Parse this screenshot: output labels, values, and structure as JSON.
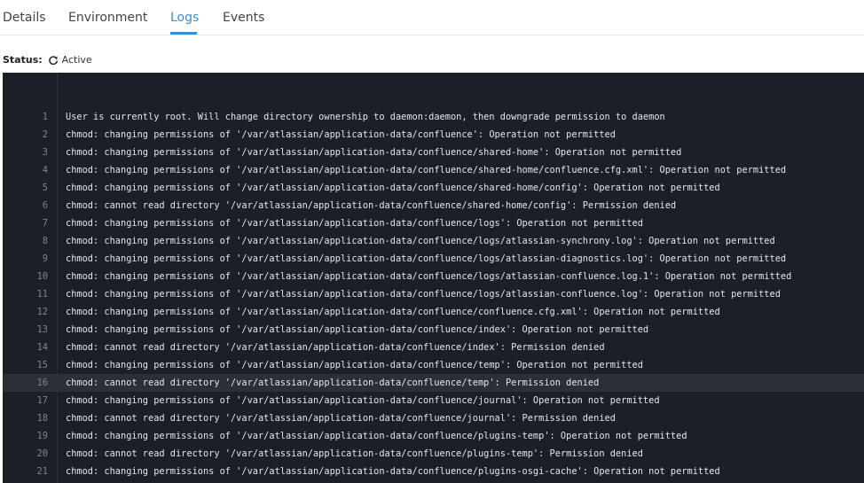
{
  "tabs": [
    {
      "label": "Details"
    },
    {
      "label": "Environment"
    },
    {
      "label": "Logs"
    },
    {
      "label": "Events"
    }
  ],
  "active_tab": "Logs",
  "status": {
    "label": "Status:",
    "icon": "refresh-icon",
    "value": "Active"
  },
  "log": {
    "highlighted_line": 16,
    "lines": [
      {
        "n": "1",
        "text": "User is currently root. Will change directory ownership to daemon:daemon, then downgrade permission to daemon"
      },
      {
        "n": "2",
        "text": "chmod: changing permissions of '/var/atlassian/application-data/confluence': Operation not permitted"
      },
      {
        "n": "3",
        "text": "chmod: changing permissions of '/var/atlassian/application-data/confluence/shared-home': Operation not permitted"
      },
      {
        "n": "4",
        "text": "chmod: changing permissions of '/var/atlassian/application-data/confluence/shared-home/confluence.cfg.xml': Operation not permitted"
      },
      {
        "n": "5",
        "text": "chmod: changing permissions of '/var/atlassian/application-data/confluence/shared-home/config': Operation not permitted"
      },
      {
        "n": "6",
        "text": "chmod: cannot read directory '/var/atlassian/application-data/confluence/shared-home/config': Permission denied"
      },
      {
        "n": "7",
        "text": "chmod: changing permissions of '/var/atlassian/application-data/confluence/logs': Operation not permitted"
      },
      {
        "n": "8",
        "text": "chmod: changing permissions of '/var/atlassian/application-data/confluence/logs/atlassian-synchrony.log': Operation not permitted"
      },
      {
        "n": "9",
        "text": "chmod: changing permissions of '/var/atlassian/application-data/confluence/logs/atlassian-diagnostics.log': Operation not permitted"
      },
      {
        "n": "10",
        "text": "chmod: changing permissions of '/var/atlassian/application-data/confluence/logs/atlassian-confluence.log.1': Operation not permitted"
      },
      {
        "n": "11",
        "text": "chmod: changing permissions of '/var/atlassian/application-data/confluence/logs/atlassian-confluence.log': Operation not permitted"
      },
      {
        "n": "12",
        "text": "chmod: changing permissions of '/var/atlassian/application-data/confluence/confluence.cfg.xml': Operation not permitted"
      },
      {
        "n": "13",
        "text": "chmod: changing permissions of '/var/atlassian/application-data/confluence/index': Operation not permitted"
      },
      {
        "n": "14",
        "text": "chmod: cannot read directory '/var/atlassian/application-data/confluence/index': Permission denied"
      },
      {
        "n": "15",
        "text": "chmod: changing permissions of '/var/atlassian/application-data/confluence/temp': Operation not permitted"
      },
      {
        "n": "16",
        "text": "chmod: cannot read directory '/var/atlassian/application-data/confluence/temp': Permission denied"
      },
      {
        "n": "17",
        "text": "chmod: changing permissions of '/var/atlassian/application-data/confluence/journal': Operation not permitted"
      },
      {
        "n": "18",
        "text": "chmod: cannot read directory '/var/atlassian/application-data/confluence/journal': Permission denied"
      },
      {
        "n": "19",
        "text": "chmod: changing permissions of '/var/atlassian/application-data/confluence/plugins-temp': Operation not permitted"
      },
      {
        "n": "20",
        "text": "chmod: cannot read directory '/var/atlassian/application-data/confluence/plugins-temp': Permission denied"
      },
      {
        "n": "21",
        "text": "chmod: changing permissions of '/var/atlassian/application-data/confluence/plugins-osgi-cache': Operation not permitted"
      }
    ]
  },
  "colors": {
    "accent": "#3a8fd0",
    "log_background": "#1b1f27",
    "log_text": "#e3e6eb",
    "line_number": "#7e8590",
    "highlight_row": "#2a2f38"
  }
}
